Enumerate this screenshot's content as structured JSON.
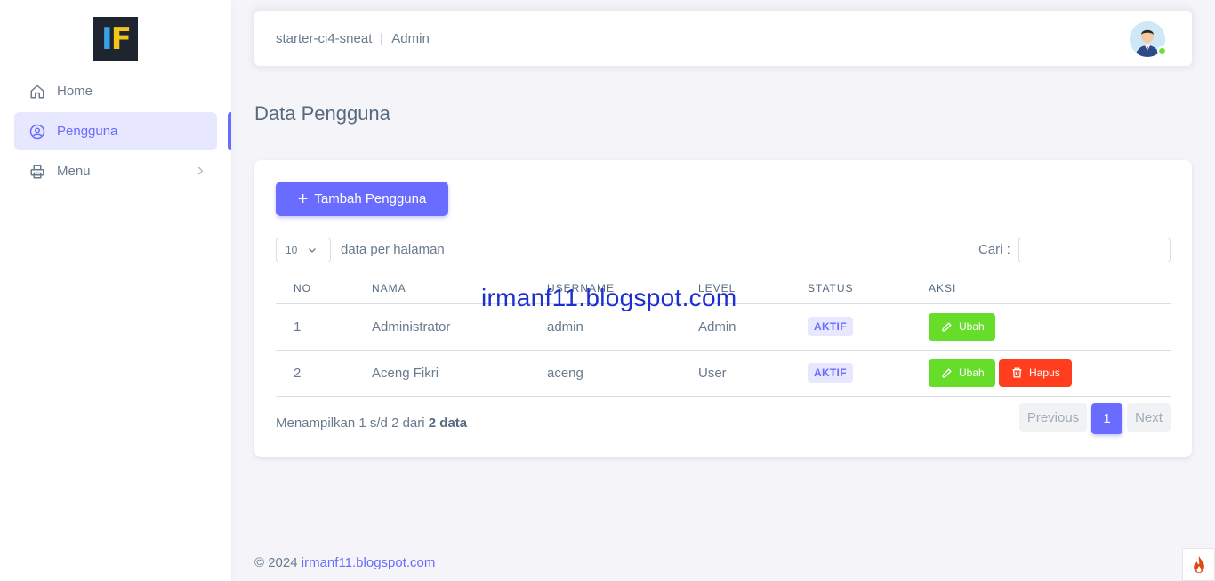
{
  "brand": {
    "logo_left": "I",
    "logo_right": "F",
    "colors": {
      "blue": "#3aa0e8",
      "yellow": "#f5c518",
      "bg": "#1e2530"
    }
  },
  "sidebar": {
    "items": [
      {
        "label": "Home",
        "icon": "home-icon"
      },
      {
        "label": "Pengguna",
        "icon": "user-circle-icon",
        "active": true
      },
      {
        "label": "Menu",
        "icon": "printer-icon",
        "has_submenu": true
      }
    ]
  },
  "navbar": {
    "app": "starter-ci4-sneat",
    "separator": "|",
    "role": "Admin"
  },
  "page": {
    "title": "Data Pengguna"
  },
  "toolbar": {
    "add_label": "Tambah Pengguna"
  },
  "table_controls": {
    "page_length": "10",
    "length_label": "data per halaman",
    "search_label": "Cari :"
  },
  "table": {
    "headers": [
      "NO",
      "NAMA",
      "USERNAME",
      "LEVEL",
      "STATUS",
      "AKSI"
    ],
    "rows": [
      {
        "no": "1",
        "nama": "Administrator",
        "username": "admin",
        "level": "Admin",
        "status": "AKTIF",
        "edit": "Ubah"
      },
      {
        "no": "2",
        "nama": "Aceng Fikri",
        "username": "aceng",
        "level": "User",
        "status": "AKTIF",
        "edit": "Ubah",
        "delete": "Hapus"
      }
    ]
  },
  "info": {
    "prefix": "Menampilkan 1 s/d 2 dari ",
    "total": "2 data"
  },
  "pagination": {
    "previous": "Previous",
    "current": "1",
    "next": "Next"
  },
  "watermark": "irmanf11.blogspot.com",
  "footer": {
    "copyright": "© 2024 ",
    "link": "irmanf11.blogspot.com"
  },
  "theme": {
    "primary": "#696cff",
    "success": "#66dd29",
    "danger": "#ff3e1d"
  }
}
